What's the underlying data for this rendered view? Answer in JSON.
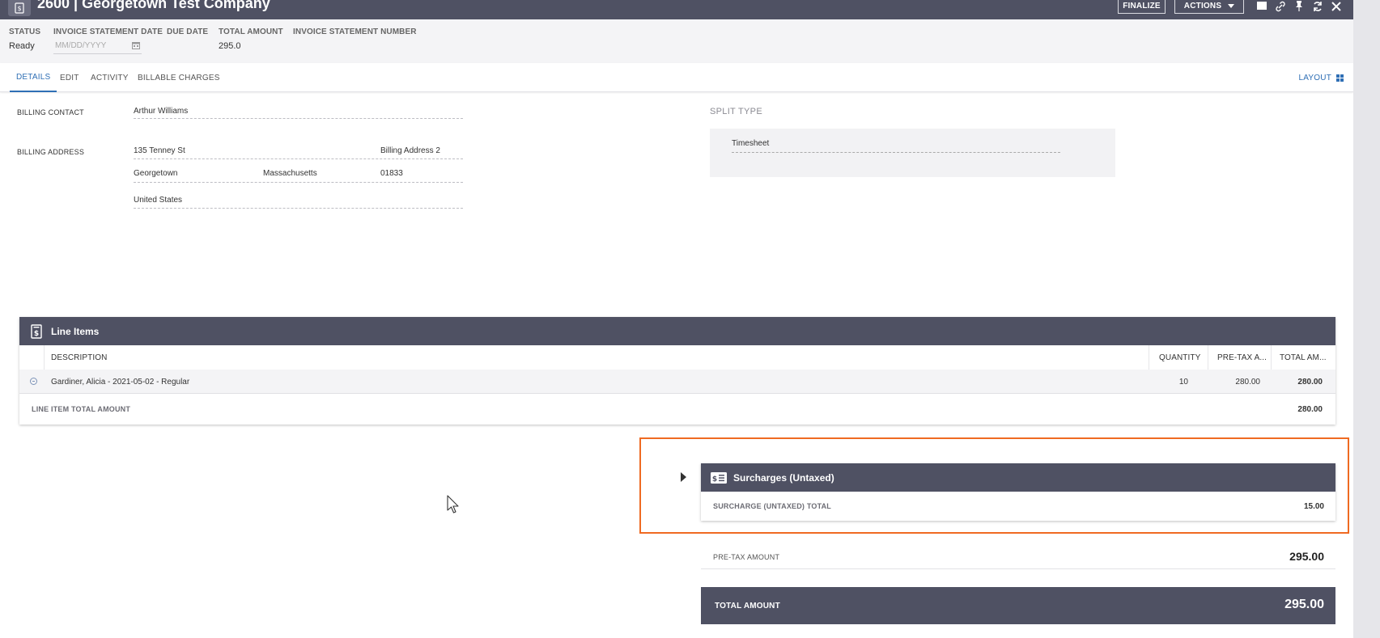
{
  "window": {
    "title": "2600 | Georgetown Test Company",
    "finalize_label": "FINALIZE",
    "actions_label": "ACTIONS",
    "icons": [
      "window-icon",
      "link-icon",
      "pin-icon",
      "refresh-icon",
      "close-icon"
    ]
  },
  "header": {
    "status": {
      "label": "STATUS",
      "value": "Ready"
    },
    "statement_date": {
      "label": "INVOICE STATEMENT DATE",
      "placeholder": "MM/DD/YYYY"
    },
    "due_date": {
      "label": "DUE DATE",
      "value": ""
    },
    "total_amount": {
      "label": "TOTAL AMOUNT",
      "value": "295.0"
    },
    "statement_number": {
      "label": "INVOICE STATEMENT NUMBER",
      "value": ""
    }
  },
  "tabs": {
    "items": [
      "DETAILS",
      "EDIT",
      "ACTIVITY",
      "BILLABLE CHARGES"
    ],
    "active": "DETAILS",
    "layout_label": "LAYOUT"
  },
  "billing": {
    "contact_label": "BILLING CONTACT",
    "contact_value": "Arthur Williams",
    "address_label": "BILLING ADDRESS",
    "address1": "135 Tenney St",
    "address2": "Billing Address 2",
    "city": "Georgetown",
    "state": "Massachusetts",
    "zip": "01833",
    "country": "United States"
  },
  "split": {
    "label": "SPLIT TYPE",
    "value": "Timesheet"
  },
  "line_items": {
    "title": "Line Items",
    "columns": [
      "DESCRIPTION",
      "QUANTITY",
      "PRE-TAX A...",
      "TOTAL AM..."
    ],
    "rows": [
      {
        "description": "Gardiner, Alicia - 2021-05-02 - Regular",
        "quantity": "10",
        "pretax": "280.00",
        "total": "280.00"
      }
    ],
    "total_label": "LINE ITEM TOTAL AMOUNT",
    "total_value": "280.00"
  },
  "surcharges": {
    "title": "Surcharges (Untaxed)",
    "total_label": "SURCHARGE (UNTAXED) TOTAL",
    "total_value": "15.00"
  },
  "totals": {
    "pretax_label": "PRE-TAX AMOUNT",
    "pretax_value": "295.00",
    "total_label": "TOTAL AMOUNT",
    "total_value": "295.00"
  },
  "colors": {
    "header_bar": "#4f5163",
    "accent_blue": "#2f6fb5",
    "highlight_orange": "#ef6a22"
  }
}
